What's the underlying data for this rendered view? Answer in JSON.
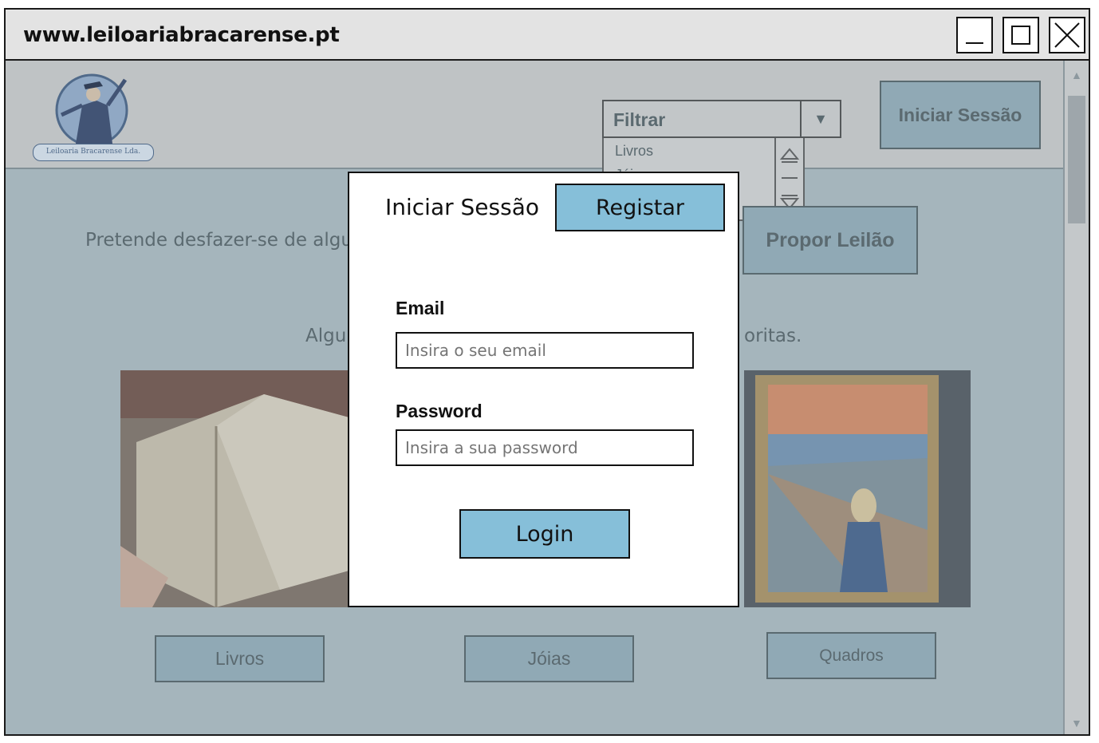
{
  "browser": {
    "url": "www.leiloariabracarense.pt",
    "buttons": {
      "minimize": "minimize",
      "maximize": "maximize",
      "close": "close"
    }
  },
  "header": {
    "logo_caption": "Leiloaria Bracarense Lda.",
    "filter": {
      "label": "Filtrar",
      "options": [
        "Livros",
        "Jóias"
      ]
    },
    "login_button": "Iniciar Sessão"
  },
  "main": {
    "promo_text": "Pretende desfazer-se de algum a",
    "propose_button": "Propor Leilão",
    "categories_text_left": "Algun",
    "categories_text_right": "oritas.",
    "categories": [
      "Livros",
      "Jóias",
      "Quadros"
    ]
  },
  "modal": {
    "title": "Iniciar Sessão",
    "register_button": "Registar",
    "email_label": "Email",
    "email_placeholder": "Insira o seu email",
    "password_label": "Password",
    "password_placeholder": "Insira a sua password",
    "login_button": "Login"
  },
  "colors": {
    "accent": "#86bfd9",
    "page_bg": "#a9b8bf",
    "muted_button": "#8fa9b6"
  }
}
